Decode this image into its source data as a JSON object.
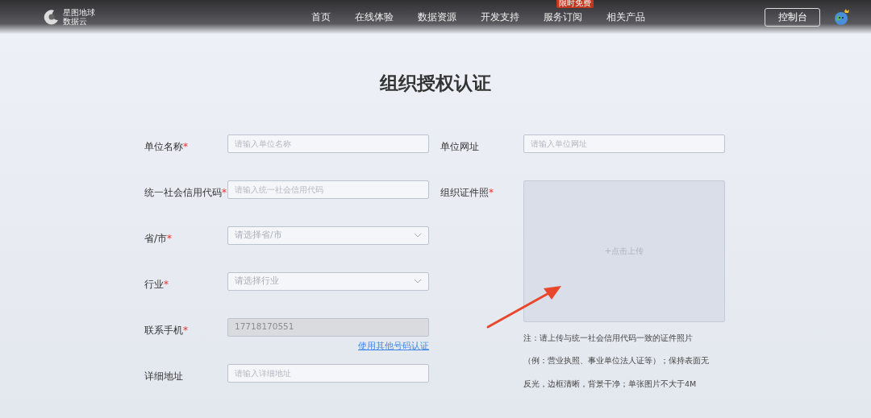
{
  "header": {
    "logo_text": [
      "星图地球",
      "数据云"
    ],
    "nav": [
      {
        "label": "首页"
      },
      {
        "label": "在线体验"
      },
      {
        "label": "数据资源"
      },
      {
        "label": "开发支持"
      },
      {
        "label": "服务订阅",
        "badge": "限时免费"
      },
      {
        "label": "相关产品"
      }
    ],
    "console_button": "控制台"
  },
  "title": "组织授权认证",
  "required_mark": "*",
  "left_fields": [
    {
      "label": "单位名称",
      "required": true,
      "kind": "input",
      "placeholder": "请输入单位名称"
    },
    {
      "label": "统一社会信用代码",
      "required": true,
      "kind": "input",
      "placeholder": "请输入统一社会信用代码"
    },
    {
      "label": "省/市",
      "required": true,
      "kind": "select",
      "placeholder": "请选择省/市"
    },
    {
      "label": "行业",
      "required": true,
      "kind": "select",
      "placeholder": "请选择行业"
    },
    {
      "label": "联系手机",
      "required": true,
      "kind": "readonly",
      "value": "17718170551",
      "link": "使用其他号码认证"
    },
    {
      "label": "详细地址",
      "required": false,
      "kind": "input",
      "placeholder": "请输入详细地址"
    }
  ],
  "right_fields": [
    {
      "label": "单位网址",
      "required": false,
      "kind": "input",
      "placeholder": "请输入单位网址"
    },
    {
      "label": "组织证件照",
      "required": true,
      "kind": "upload",
      "upload_text": "+点击上传",
      "note": [
        "注：请上传与统一社会信用代码一致的证件照片",
        "（例：营业执照、事业单位法人证等）；保持表面无",
        "反光，边框清晰，背景干净；单张图片不大于4M"
      ]
    }
  ]
}
